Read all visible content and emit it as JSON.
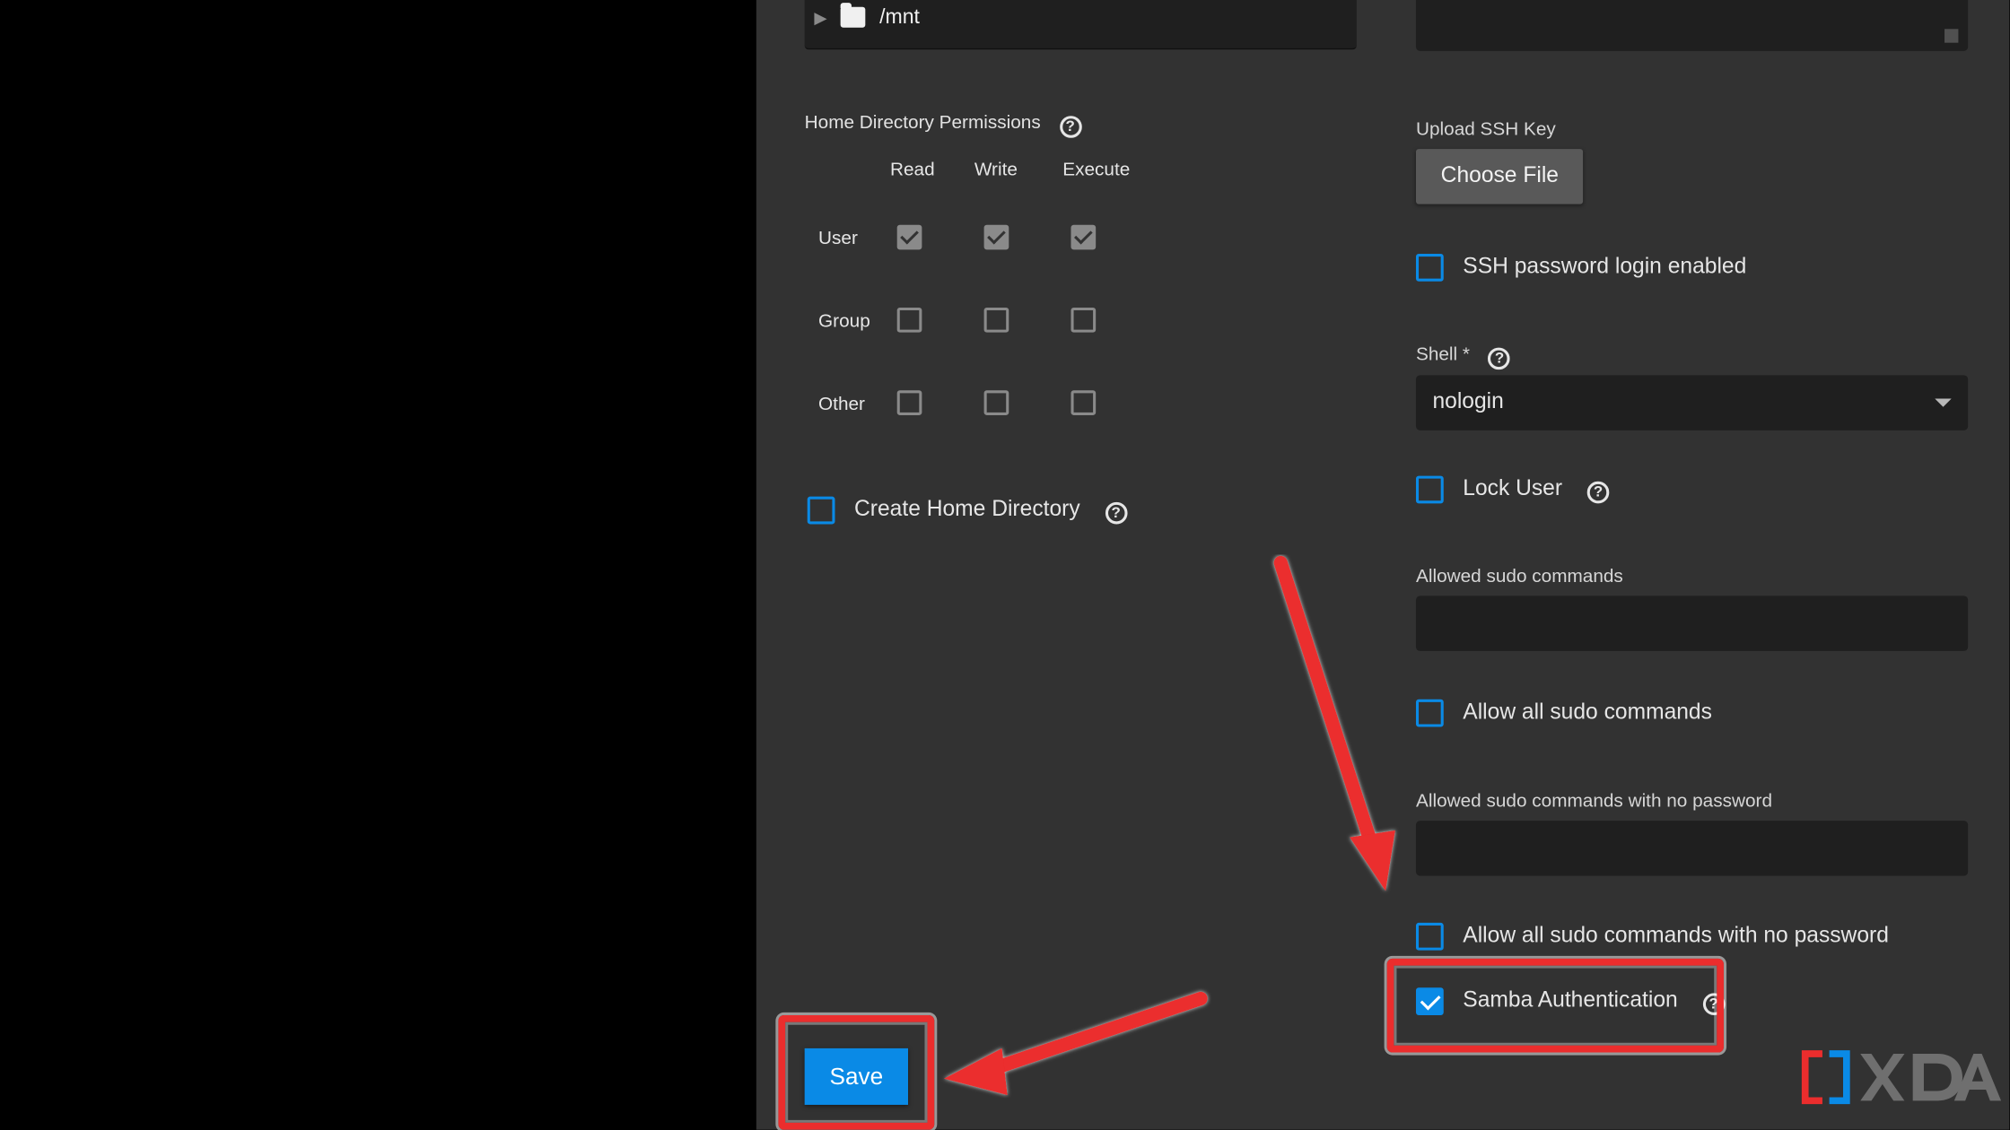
{
  "tree": {
    "mnt_label": "/mnt"
  },
  "perm": {
    "section_label": "Home Directory Permissions",
    "headers": {
      "read": "Read",
      "write": "Write",
      "execute": "Execute"
    },
    "rows": {
      "user": "User",
      "group": "Group",
      "other": "Other"
    }
  },
  "create_home": {
    "label": "Create Home Directory"
  },
  "ssh": {
    "upload_label": "Upload SSH Key",
    "choose_file": "Choose File",
    "pw_login_label": "SSH password login enabled"
  },
  "shell": {
    "label": "Shell *",
    "value": "nologin"
  },
  "lock_user": {
    "label": "Lock User"
  },
  "sudo": {
    "allowed_label": "Allowed sudo commands",
    "allow_all_label": "Allow all sudo commands",
    "allowed_nopw_label": "Allowed sudo commands with no password",
    "allow_all_nopw_label": "Allow all sudo commands with no password"
  },
  "samba": {
    "label": "Samba Authentication"
  },
  "buttons": {
    "save": "Save"
  },
  "logo": {
    "text": "XDA"
  }
}
